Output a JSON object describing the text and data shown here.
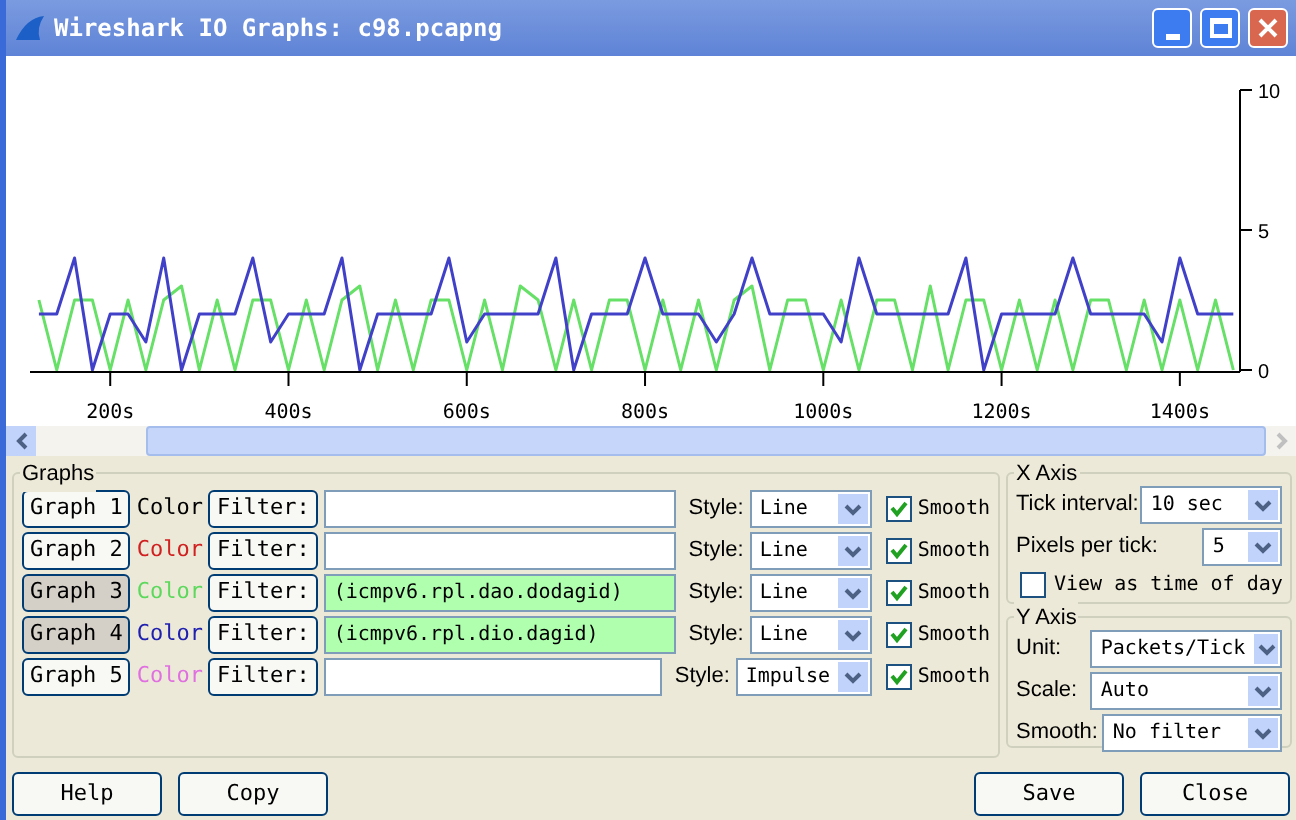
{
  "window": {
    "title": "Wireshark IO Graphs: c98.pcapng"
  },
  "chart": {
    "chart_data": {
      "type": "line",
      "x": [
        120,
        140,
        160,
        180,
        200,
        220,
        240,
        260,
        280,
        300,
        320,
        340,
        360,
        380,
        400,
        420,
        440,
        460,
        480,
        500,
        520,
        540,
        560,
        580,
        600,
        620,
        640,
        660,
        680,
        700,
        720,
        740,
        760,
        780,
        800,
        820,
        840,
        860,
        880,
        900,
        920,
        940,
        960,
        980,
        1000,
        1020,
        1040,
        1060,
        1080,
        1100,
        1120,
        1140,
        1160,
        1180,
        1200,
        1220,
        1240,
        1260,
        1280,
        1300,
        1320,
        1340,
        1360,
        1380,
        1400,
        1420,
        1440,
        1460
      ],
      "series": [
        {
          "color": "#66e066",
          "values": [
            2.5,
            0,
            2.5,
            2.5,
            0,
            2.5,
            0,
            2.5,
            3,
            0,
            2.5,
            0,
            2.5,
            2.5,
            0,
            2.5,
            0,
            2.5,
            3,
            0,
            2.5,
            0,
            2.5,
            2.5,
            0,
            2.5,
            0,
            3,
            2.5,
            0,
            2.5,
            0,
            2.5,
            2.5,
            0,
            2.5,
            0,
            2.5,
            0,
            2.5,
            3,
            0,
            2.5,
            2.5,
            0,
            2.5,
            0,
            2.5,
            2.5,
            0,
            3,
            0,
            2.5,
            2.5,
            0,
            2.5,
            0,
            2.5,
            0,
            2.5,
            2.5,
            0,
            2.5,
            0,
            2.5,
            0,
            2.5,
            0
          ]
        },
        {
          "color": "#4040c8",
          "values": [
            2,
            2,
            4,
            0,
            2,
            2,
            1,
            4,
            0,
            2,
            2,
            2,
            4,
            1,
            2,
            2,
            2,
            4,
            0,
            2,
            2,
            2,
            2,
            4,
            1,
            2,
            2,
            2,
            2,
            4,
            0,
            2,
            2,
            2,
            4,
            2,
            2,
            2,
            1,
            2,
            4,
            2,
            2,
            2,
            2,
            1,
            4,
            2,
            2,
            2,
            2,
            2,
            4,
            0,
            2,
            2,
            2,
            2,
            4,
            2,
            2,
            2,
            2,
            1,
            4,
            2,
            2,
            2
          ]
        }
      ],
      "xlim": [
        110,
        1463
      ],
      "ylim": [
        0,
        10
      ],
      "xticks": [
        {
          "value": 200,
          "label": "200s"
        },
        {
          "value": 400,
          "label": "400s"
        },
        {
          "value": 600,
          "label": "600s"
        },
        {
          "value": 800,
          "label": "800s"
        },
        {
          "value": 1000,
          "label": "1000s"
        },
        {
          "value": 1200,
          "label": "1200s"
        },
        {
          "value": 1400,
          "label": "1400s"
        }
      ],
      "yticks": [
        0,
        5,
        10
      ]
    }
  },
  "graphs": {
    "title": "Graphs",
    "items": [
      {
        "button": "Graph 1",
        "on": false,
        "color_label": "Color",
        "color": "#000000",
        "filter_button": "Filter:",
        "style_label": "Style:",
        "style": "Line",
        "smooth": {
          "label": "Smooth",
          "checked": true
        }
      },
      {
        "button": "Graph 2",
        "on": false,
        "color_label": "Color",
        "color": "#d02020",
        "filter_button": "Filter:",
        "style_label": "Style:",
        "style": "Line",
        "smooth": {
          "label": "Smooth",
          "checked": true
        }
      },
      {
        "button": "Graph 3",
        "on": true,
        "color_label": "Color",
        "color": "#5cd85c",
        "filter_button": "Filter:",
        "filter": "(icmpv6.rpl.dao.dodagid)",
        "style_label": "Style:",
        "style": "Line",
        "smooth": {
          "label": "Smooth",
          "checked": true
        }
      },
      {
        "button": "Graph 4",
        "on": true,
        "color_label": "Color",
        "color": "#2020b0",
        "filter_button": "Filter:",
        "filter": "(icmpv6.rpl.dio.dagid)",
        "style_label": "Style:",
        "style": "Line",
        "smooth": {
          "label": "Smooth",
          "checked": true
        }
      },
      {
        "button": "Graph 5",
        "on": false,
        "color_label": "Color",
        "color": "#e070e0",
        "filter_button": "Filter:",
        "style_label": "Style:",
        "style": "Impulse",
        "smooth": {
          "label": "Smooth",
          "checked": true
        }
      }
    ]
  },
  "x_axis": {
    "title": "X Axis",
    "tick_interval_label": "Tick interval:",
    "tick_interval": "10 sec",
    "pixels_per_tick_label": "Pixels per tick:",
    "pixels_per_tick": "5",
    "time_of_day": {
      "label": "View as time of day",
      "checked": false
    }
  },
  "y_axis": {
    "title": "Y Axis",
    "unit_label": "Unit:",
    "unit": "Packets/Tick",
    "scale_label": "Scale:",
    "scale": "Auto",
    "smooth_label": "Smooth:",
    "smooth": "No filter"
  },
  "buttons": {
    "left": [
      "Help",
      "Copy"
    ],
    "right": [
      "Save",
      "Close"
    ]
  }
}
